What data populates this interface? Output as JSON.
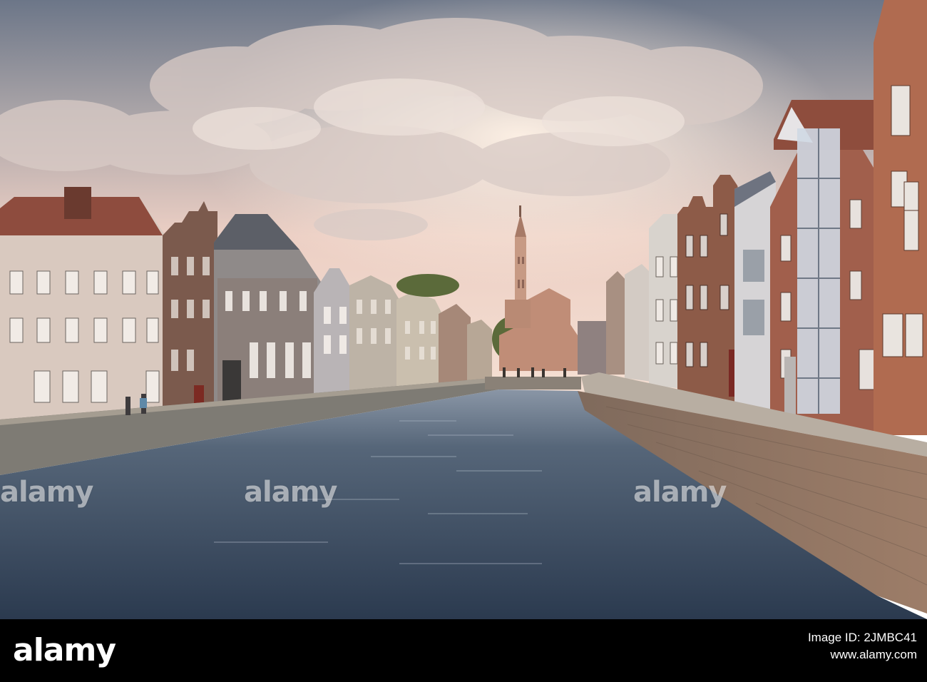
{
  "watermark": {
    "text": "alamy"
  },
  "footer": {
    "logo_text": "alamy",
    "image_id_label": "Image ID: 2JMBC41",
    "site_url": "www.alamy.com"
  },
  "colors": {
    "footer_background": "#000000",
    "canal_water": "#3b4c62",
    "sky_glow": "#f3d6c9",
    "brick": "#9a5a4a"
  }
}
